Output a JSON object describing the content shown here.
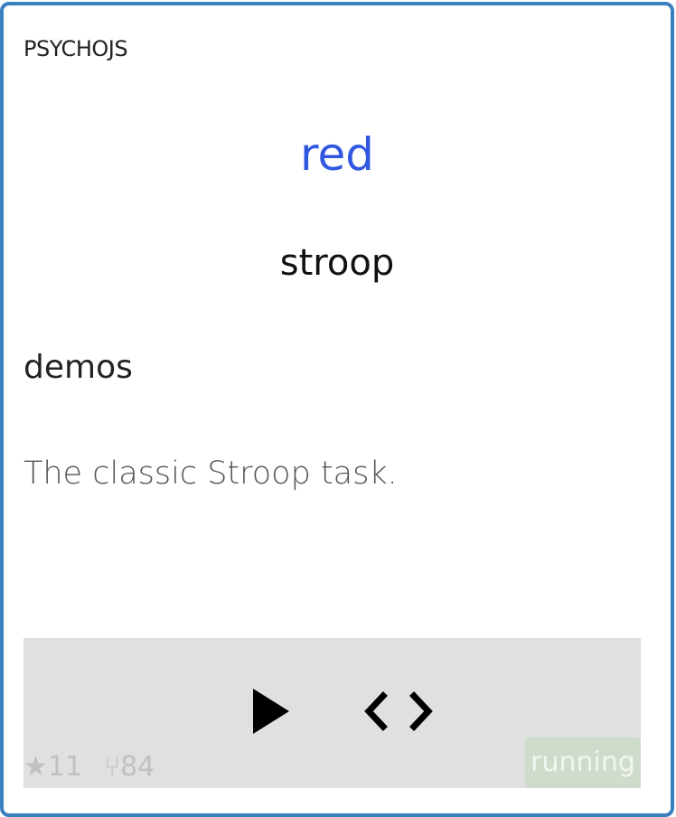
{
  "card": {
    "platform": "PSYCHOJS",
    "stimulus_word": "red",
    "stimulus_color": "#2f57e0",
    "title": "stroop",
    "category": "demos",
    "description": "The classic Stroop task."
  },
  "footer": {
    "play_icon": "play-icon",
    "code_icon": "code-icon",
    "stars_symbol": "★",
    "stars": "11",
    "forks_symbol": "⑂",
    "forks": "84",
    "status": "running"
  }
}
